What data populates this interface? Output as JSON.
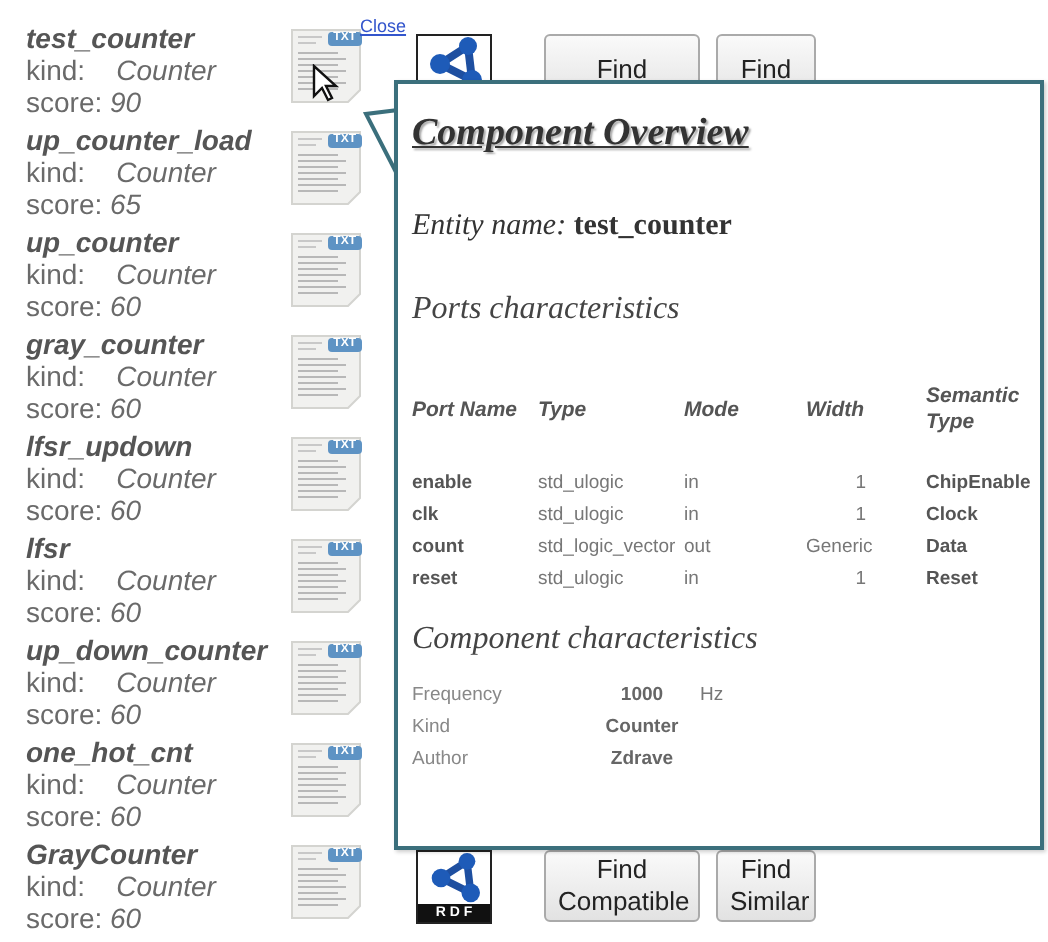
{
  "close_link": "Close",
  "results": [
    {
      "name": "test_counter",
      "kind_label": "kind:",
      "kind": "Counter",
      "score_label": "score:",
      "score": "90",
      "file_tag": "TXT",
      "actions": {
        "buttons": [
          "Find",
          "Find"
        ]
      }
    },
    {
      "name": "up_counter_load",
      "kind_label": "kind:",
      "kind": "Counter",
      "score_label": "score:",
      "score": "65",
      "file_tag": "TXT"
    },
    {
      "name": "up_counter",
      "kind_label": "kind:",
      "kind": "Counter",
      "score_label": "score:",
      "score": "60",
      "file_tag": "TXT"
    },
    {
      "name": "gray_counter",
      "kind_label": "kind:",
      "kind": "Counter",
      "score_label": "score:",
      "score": "60",
      "file_tag": "TXT"
    },
    {
      "name": "lfsr_updown",
      "kind_label": "kind:",
      "kind": "Counter",
      "score_label": "score:",
      "score": "60",
      "file_tag": "TXT"
    },
    {
      "name": "lfsr",
      "kind_label": "kind:",
      "kind": "Counter",
      "score_label": "score:",
      "score": "60",
      "file_tag": "TXT"
    },
    {
      "name": "up_down_counter",
      "kind_label": "kind:",
      "kind": "Counter",
      "score_label": "score:",
      "score": "60",
      "file_tag": "TXT"
    },
    {
      "name": "one_hot_cnt",
      "kind_label": "kind:",
      "kind": "Counter",
      "score_label": "score:",
      "score": "60",
      "file_tag": "TXT"
    },
    {
      "name": "GrayCounter",
      "kind_label": "kind:",
      "kind": "Counter",
      "score_label": "score:",
      "score": "60",
      "file_tag": "TXT",
      "actions": {
        "rdf_label": "R D F",
        "buttons": [
          "Find Compatible",
          "Find Similar"
        ]
      }
    }
  ],
  "popover": {
    "title": "Component Overview",
    "entity_label": "Entity name:",
    "entity": "test_counter",
    "ports_heading": "Ports characteristics",
    "columns": [
      "Port Name",
      "Type",
      "Mode",
      "Width",
      "Semantic Type"
    ],
    "ports": [
      [
        "enable",
        "std_ulogic",
        "in",
        "1",
        "ChipEnable"
      ],
      [
        "clk",
        "std_ulogic",
        "in",
        "1",
        "Clock"
      ],
      [
        "count",
        "std_logic_vector",
        "out",
        "Generic",
        "Data"
      ],
      [
        "reset",
        "std_ulogic",
        "in",
        "1",
        "Reset"
      ]
    ],
    "component_heading": "Component characteristics",
    "characteristics": [
      {
        "label": "Frequency",
        "value": "1000",
        "unit": "Hz"
      },
      {
        "label": "Kind",
        "value": "Counter"
      },
      {
        "label": "Author",
        "value": "Zdrave"
      }
    ]
  }
}
